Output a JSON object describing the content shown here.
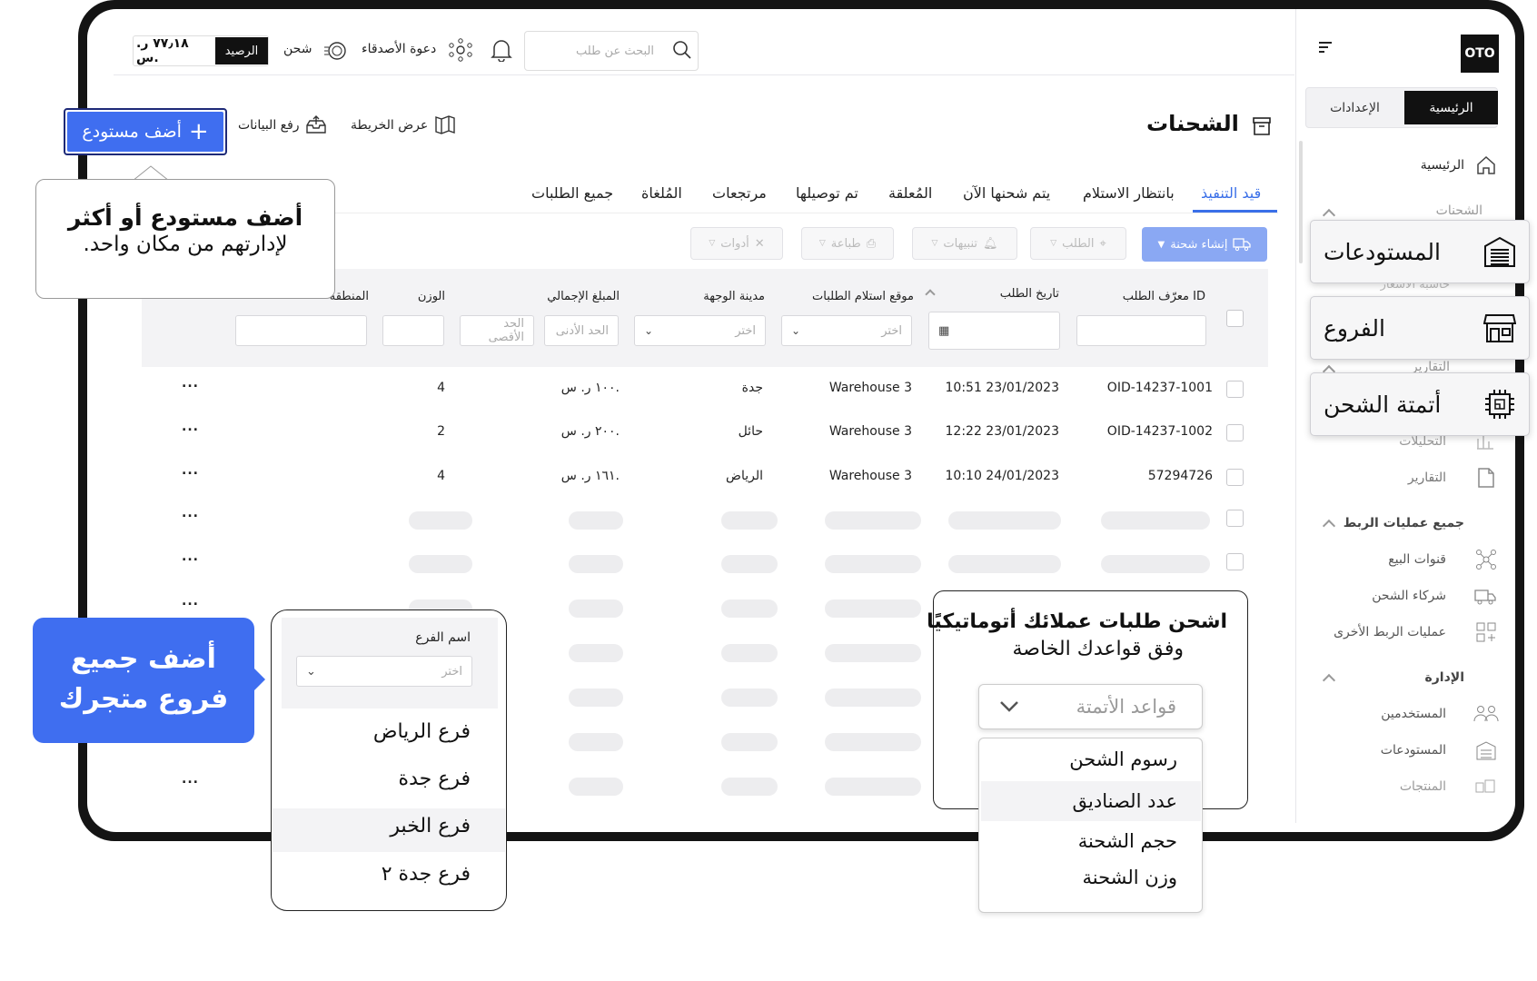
{
  "sidebar": {
    "logo": "OTO",
    "seg_home": "الرئيسية",
    "seg_settings": "الإعدادات",
    "home": "الرئيسية",
    "shipments_section": "الشحنات",
    "peek_rates": "حاسبة الأسعار",
    "reports_section": "التقارير",
    "analytics": "التحليلات",
    "reports": "التقارير",
    "integrations_section": "جميع عمليات الربط",
    "sales_channels": "قنوات البيع",
    "shipping_partners": "شركاء الشحن",
    "other_integrations": "عمليات الربط الأخرى",
    "admin_section": "الإدارة",
    "users": "المستخدمين",
    "warehouses": "المستودعات",
    "products": "المنتجات"
  },
  "popouts": {
    "warehouses": "المستودعات",
    "branches": "الفروع",
    "automation": "أتمتة الشحن"
  },
  "header": {
    "search_placeholder": "البحث عن طلب",
    "invite": "دعوة الأصدقاء",
    "charge": "شحن",
    "balance_label": "الرصيد",
    "balance_value": "٧٧٫١٨ ر. س."
  },
  "page": {
    "title": "الشحنات",
    "map_view": "عرض الخريطة",
    "upload_data": "رفع البيانات",
    "add_warehouse": "أضف مستودع"
  },
  "tabs": [
    "قيد التنفيذ",
    "بانتظار الاستلام",
    "يتم شحنها الآن",
    "المُعلقة",
    "تم توصيلها",
    "مرتجعات",
    "المُلغاة",
    "جميع الطلبات"
  ],
  "toolbar": {
    "create": "إنشاء شحنة",
    "order": "الطلب",
    "alerts": "تنبيهات",
    "print": "طباعة",
    "tools": "أدوات"
  },
  "table": {
    "headers": {
      "order_id": "معرّف الطلب ID",
      "order_date": "تاريخ الطلب",
      "pickup": "موقع استلام الطلبات",
      "city": "مدينة الوجهة",
      "total": "المبلغ الإجمالي",
      "weight": "الوزن",
      "region": "المنطقة"
    },
    "filters": {
      "choose": "اختر",
      "min": "الحد الأدنى",
      "max": "الحد الأقصى"
    },
    "rows": [
      {
        "id": "OID-14237-1001",
        "date": "10:51 23/01/2023",
        "pickup": "Warehouse 3",
        "city": "جدة",
        "total": "١٠٠ ر. س.",
        "weight": "4"
      },
      {
        "id": "OID-14237-1002",
        "date": "12:22 23/01/2023",
        "pickup": "Warehouse 3",
        "city": "حائل",
        "total": "٢٠٠ ر. س.",
        "weight": "2"
      },
      {
        "id": "57294726",
        "date": "10:10 24/01/2023",
        "pickup": "Warehouse 3",
        "city": "الرياض",
        "total": "١٦١ ر. س.",
        "weight": "4"
      }
    ],
    "more": "..."
  },
  "callout_wh": {
    "line1": "أضف مستودع أو أكثر",
    "line2": "لإدارتهم من مكان واحد."
  },
  "callout_branches": {
    "line1": "أضف جميع",
    "line2": "فروع متجرك"
  },
  "branch_card": {
    "label": "اسم الفرع",
    "placeholder": "اختر",
    "options": [
      "فرع الرياض",
      "فرع جدة",
      "فرع الخبر",
      "فرع جدة ٢"
    ]
  },
  "auto_card": {
    "line1": "اشحن طلبات عملائك أتوماتيكيًا",
    "line2": "وفق قواعدك الخاصة",
    "select": "قواعد الأتمتة",
    "options": [
      "رسوم الشحن",
      "عدد الصناديق",
      "حجم الشحنة",
      "وزن الشحنة"
    ]
  }
}
